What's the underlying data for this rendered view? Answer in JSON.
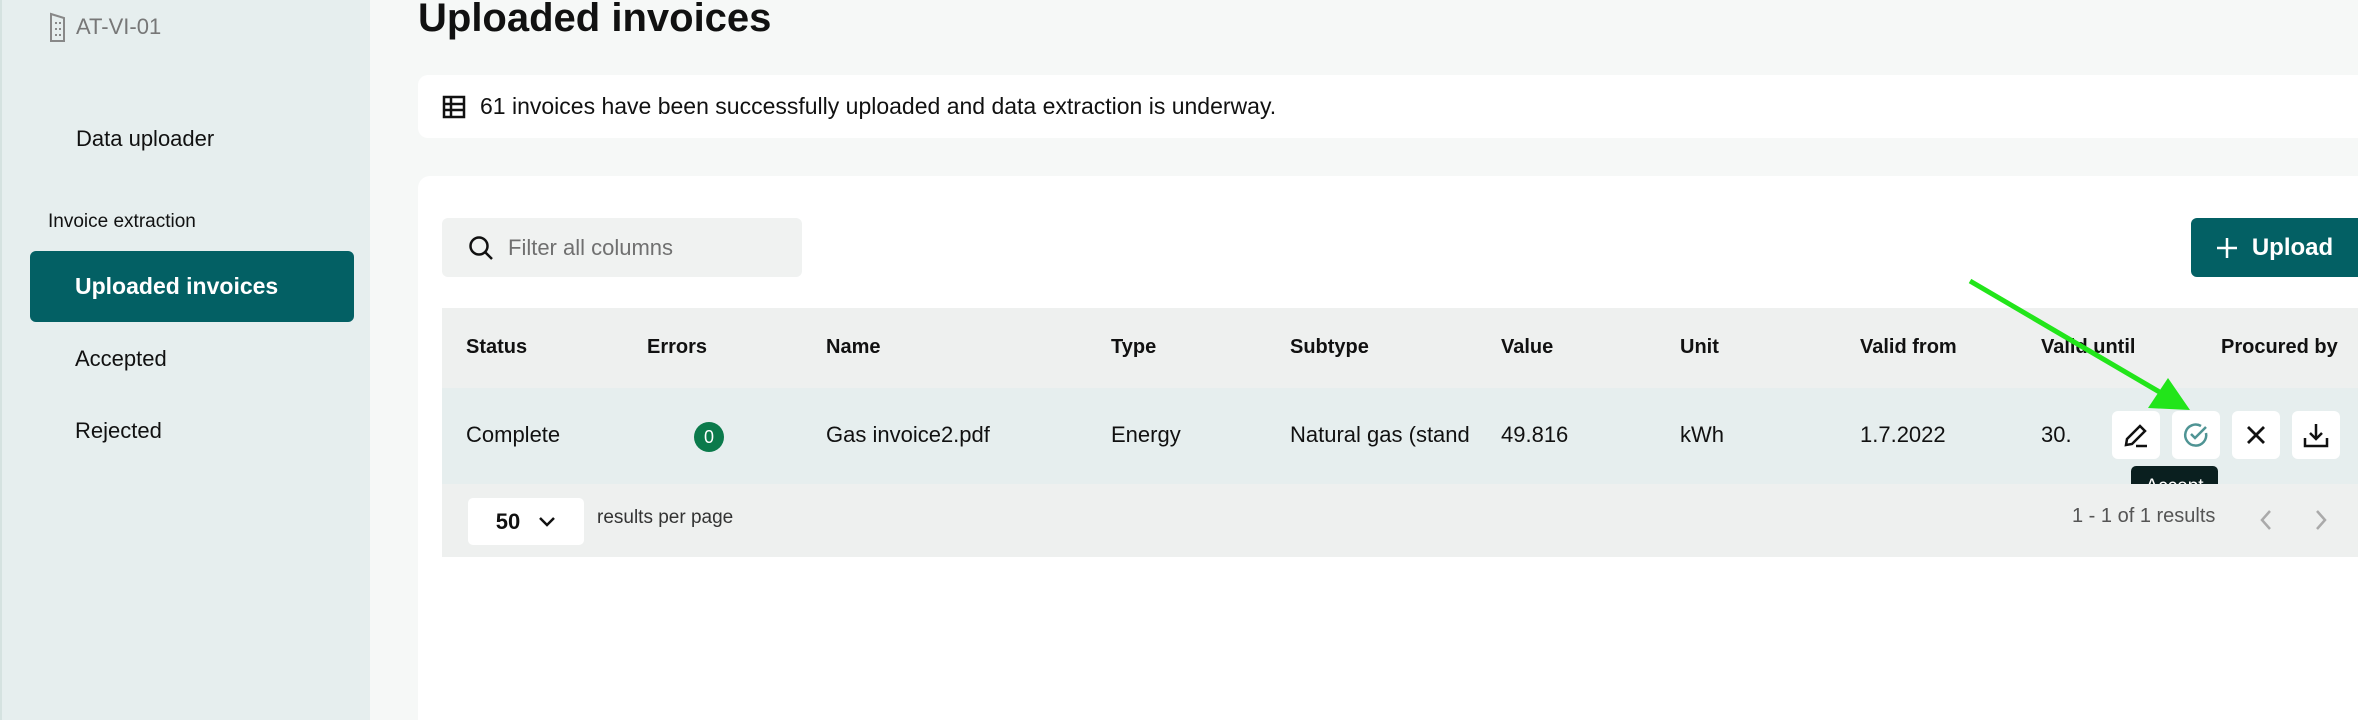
{
  "sidebar": {
    "site": "AT-VI-01",
    "data_uploader": "Data uploader",
    "section": "Invoice extraction",
    "items": [
      {
        "label": "Uploaded invoices",
        "selected": true
      },
      {
        "label": "Accepted"
      },
      {
        "label": "Rejected"
      }
    ]
  },
  "page": {
    "title": "Uploaded invoices",
    "banner": "61 invoices have been successfully uploaded and data extraction is underway."
  },
  "toolbar": {
    "search_placeholder": "Filter all columns",
    "upload_label": "Upload"
  },
  "table": {
    "columns": [
      "Status",
      "Errors",
      "Name",
      "Type",
      "Subtype",
      "Value",
      "Unit",
      "Valid from",
      "Valid until",
      "Procured by"
    ],
    "rows": [
      {
        "status": "Complete",
        "errors": "0",
        "name": "Gas invoice2.pdf",
        "type": "Energy",
        "subtype": "Natural gas (stand",
        "value": "49.816",
        "unit": "kWh",
        "valid_from": "1.7.2022",
        "valid_until": "30."
      }
    ]
  },
  "actions": {
    "tooltip": "Accept",
    "icons": [
      "edit-icon",
      "accept-check-icon",
      "reject-x-icon",
      "download-icon"
    ]
  },
  "pagination": {
    "per_page": "50",
    "per_page_label": "results per page",
    "summary": "1 - 1 of 1 results"
  },
  "colors": {
    "primary": "#036064",
    "badge": "#0b7a4b",
    "annotation_arrow": "#22e51a"
  }
}
